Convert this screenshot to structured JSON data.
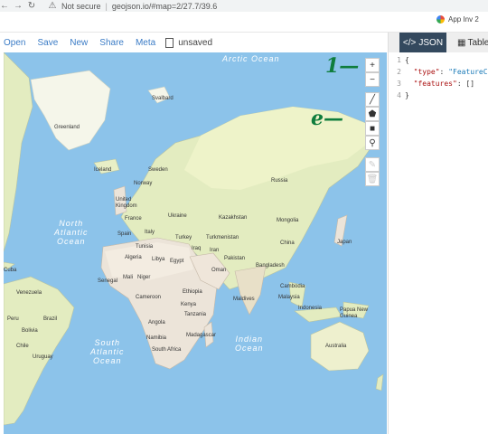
{
  "browser": {
    "security_label": "Not secure",
    "url": "geojson.io/#map=2/27.7/39.6",
    "bookmark": "App Inv 2"
  },
  "toolbar": {
    "items": [
      "Open",
      "Save",
      "New",
      "Share",
      "Meta"
    ],
    "status": "unsaved"
  },
  "map": {
    "oceans": {
      "arctic": "Arctic Ocean",
      "north_atlantic": "North\nAtlantic\nOcean",
      "south_atlantic": "South\nAtlantic\nOcean",
      "indian": "Indian\nOcean"
    },
    "labels": {
      "svalbard": "Svalbard",
      "greenland": "Greenland",
      "iceland": "Iceland",
      "sweden": "Sweden",
      "norway": "Norway",
      "uk": "United\nKingdom",
      "france": "France",
      "ukraine": "Ukraine",
      "spain": "Spain",
      "italy": "Italy",
      "turkey": "Turkey",
      "kazakhstan": "Kazakhstan",
      "mongolia": "Mongolia",
      "russia": "Russia",
      "turkmenistan": "Turkmenistan",
      "china": "China",
      "japan": "Japan",
      "tunisia": "Tunisia",
      "iraq": "Iraq",
      "iran": "Iran",
      "algeria": "Algeria",
      "libya": "Libya",
      "egypt": "Egypt",
      "pakistan": "Pakistan",
      "oman": "Oman",
      "bangladesh": "Bangladesh",
      "mali": "Mali",
      "niger": "Niger",
      "senegal": "Senegal",
      "cuba": "Cuba",
      "venezuela": "Venezuela",
      "cameroon": "Cameroon",
      "ethiopia": "Ethiopia",
      "cambodia": "Cambodia",
      "kenya": "Kenya",
      "maldives": "Maldives",
      "malaysia": "Malaysia",
      "peru": "Peru",
      "brazil": "Brazil",
      "tanzania": "Tanzania",
      "indonesia": "Indonesia",
      "papua": "Papua New\nGuinea",
      "angola": "Angola",
      "bolivia": "Bolivia",
      "namibia": "Namibia",
      "madagascar": "Madagascar",
      "chile": "Chile",
      "uruguay": "Uruguay",
      "south_africa": "South Africa",
      "australia": "Australia"
    },
    "controls": {
      "zoom_in": "+",
      "zoom_out": "−"
    },
    "annotations": {
      "one": "1—",
      "two": "e—"
    }
  },
  "panel": {
    "tab_json": "JSON",
    "tab_table": "Table",
    "line_numbers": [
      "1",
      "2",
      "3",
      "4"
    ],
    "code": {
      "open": "{",
      "type_key": "\"type\"",
      "type_val": "\"FeatureC",
      "features_key": "\"features\"",
      "features_val": "[]",
      "close": "}"
    }
  }
}
